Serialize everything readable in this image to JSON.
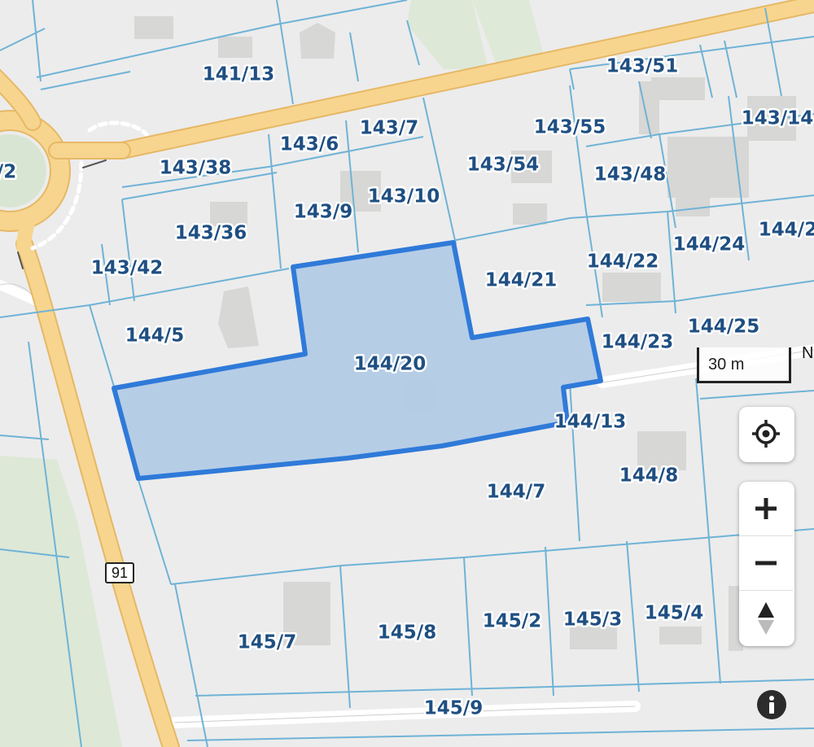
{
  "parcels": [
    {
      "label": "141/13"
    },
    {
      "label": "143/51"
    },
    {
      "label": "143/7"
    },
    {
      "label": "143/55"
    },
    {
      "label": "143/14"
    },
    {
      "label": "143/6"
    },
    {
      "label": "143/38"
    },
    {
      "label": "143/54"
    },
    {
      "label": "143/48"
    },
    {
      "label": "143/10"
    },
    {
      "label": "143/9"
    },
    {
      "label": "143/36"
    },
    {
      "label": "144/24"
    },
    {
      "label": "144/2"
    },
    {
      "label": "143/42"
    },
    {
      "label": "144/21"
    },
    {
      "label": "144/22"
    },
    {
      "label": "144/5"
    },
    {
      "label": "144/25"
    },
    {
      "label": "144/23"
    },
    {
      "label": "144/20"
    },
    {
      "label": "144/13"
    },
    {
      "label": "144/8"
    },
    {
      "label": "144/7"
    },
    {
      "label": "145/2"
    },
    {
      "label": "145/3"
    },
    {
      "label": "145/4"
    },
    {
      "label": "145/8"
    },
    {
      "label": "145/7"
    },
    {
      "label": "145/9"
    },
    {
      "label": "/2"
    }
  ],
  "selected_parcel": "144/20",
  "road_number": "91",
  "scale": {
    "label": "30 m"
  },
  "colors": {
    "background": "#ececec",
    "parcel_line": "#6fb3d6",
    "main_road": "#f7d58e",
    "selection_fill": "#b3cbe6",
    "selection_stroke": "#2f7ad9",
    "parcel_label": "#1f4f82",
    "green_area": "#dde8d7",
    "building": "#d6d6d6"
  },
  "controls": {
    "locate_icon": "crosshair-icon",
    "zoom_in_icon": "plus-icon",
    "zoom_out_icon": "minus-icon",
    "compass_icon": "compass-icon",
    "info_icon": "info-icon"
  }
}
